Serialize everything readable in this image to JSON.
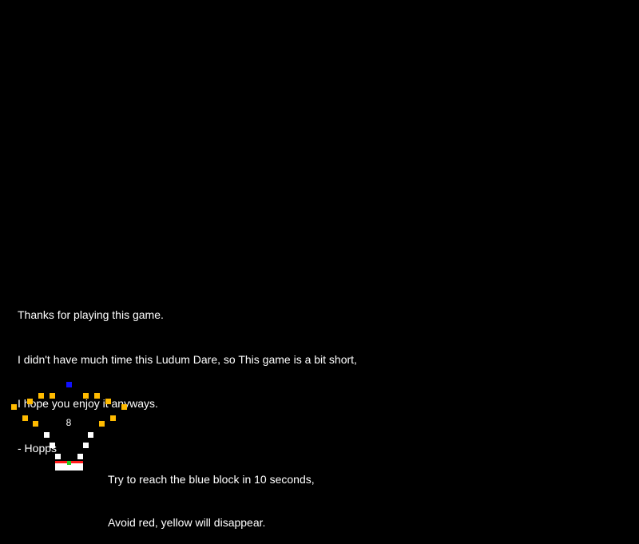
{
  "ending": {
    "lines": [
      "Thanks for playing this game.",
      "I didn't have much time this Ludum Dare, so This game is a bit short,",
      "I hope you enjoy it anyways.",
      "- Hopps"
    ]
  },
  "hud": {
    "timer_value": "8"
  },
  "instructions": {
    "lines": [
      "Try to reach the blue block in 10 seconds,",
      "Avoid red, yellow will disappear."
    ]
  },
  "colors": {
    "background": "#000000",
    "text": "#ffffff",
    "goal_block": "#1010ff",
    "disappearing_block": "#ffbb00",
    "solid_block": "#ffffff",
    "hazard": "#ff1a1a",
    "player": "#22cc22"
  }
}
